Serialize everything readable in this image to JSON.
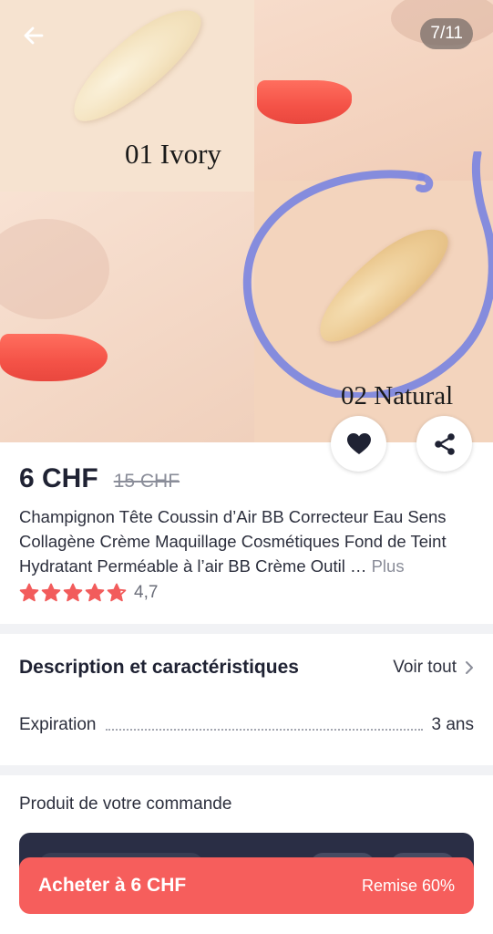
{
  "gallery": {
    "counter": "7/11",
    "shade_1": "01 Ivory",
    "shade_2": "02 Natural"
  },
  "product": {
    "price": "6 CHF",
    "old_price": "15 CHF",
    "title": "Champignon Tête Coussin d’Air BB Correcteur Eau Sens Collagène Crème Maquillage Cosmétiques Fond de Teint Hydratant Perméable à l’air BB Crème Outil …",
    "more": "Plus",
    "rating": "4,7",
    "rating_stars": 4.7
  },
  "description": {
    "title": "Description et caractéristiques",
    "see_all": "Voir tout",
    "spec_label": "Expiration",
    "spec_value": "3 ans"
  },
  "order": {
    "label": "Produit de votre commande"
  },
  "buy": {
    "label": "Acheter à 6 CHF",
    "discount": "Remise 60%"
  },
  "colors": {
    "accent": "#f65e5c",
    "star": "#f25c5c",
    "dark_card": "#2a2e45"
  }
}
